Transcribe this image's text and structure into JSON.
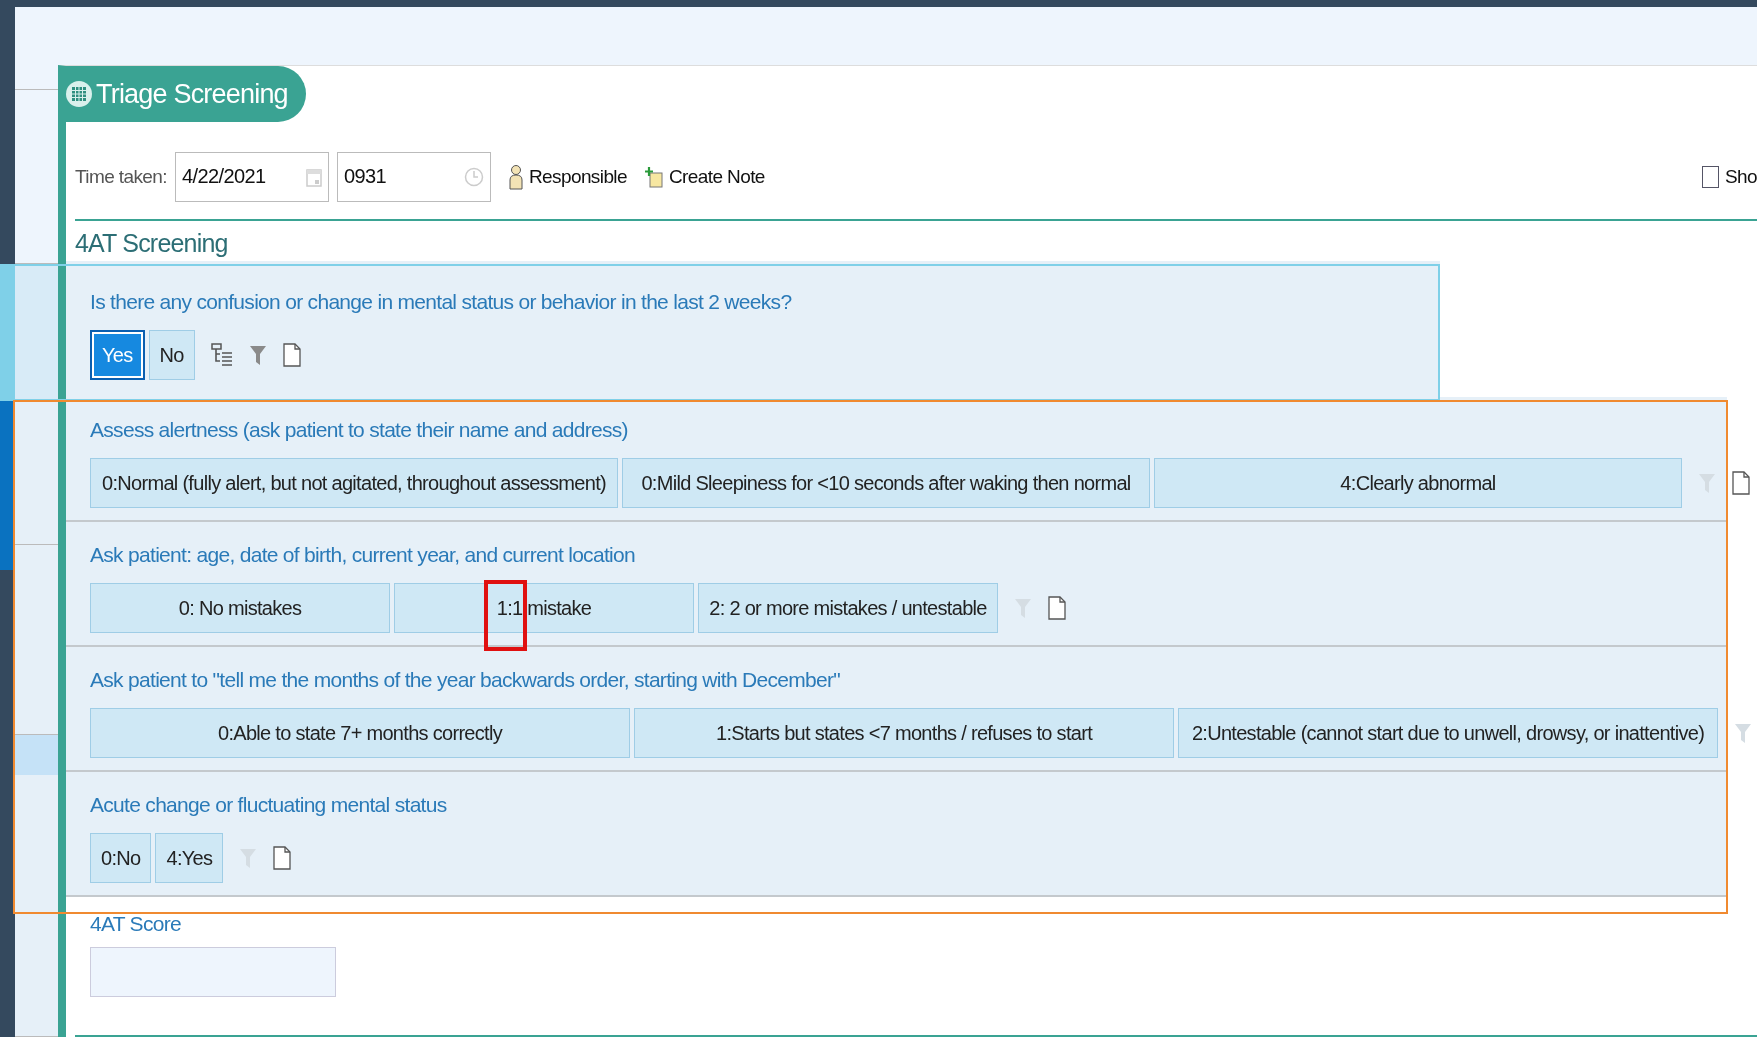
{
  "header": {
    "title": "Triage Screening"
  },
  "time_taken": {
    "label": "Time taken:",
    "date": "4/22/2021",
    "time": "0931"
  },
  "actions": {
    "responsible": "Responsible",
    "create_note": "Create Note"
  },
  "show_checkbox": {
    "label": "Sho",
    "checked": false
  },
  "section": {
    "title": "4AT Screening"
  },
  "questions": [
    {
      "text": "Is there any confusion or change in mental status or behavior in the last 2 weeks?",
      "options": [
        {
          "label": "Yes",
          "selected": true
        },
        {
          "label": "No",
          "selected": false
        }
      ]
    },
    {
      "text": "Assess alertness (ask patient to state their name and address)",
      "options": [
        {
          "label": "0:Normal (fully alert, but not agitated, throughout assessment)",
          "selected": false
        },
        {
          "label": "0:Mild Sleepiness for <10 seconds after waking then normal",
          "selected": false
        },
        {
          "label": "4:Clearly abnormal",
          "selected": false
        }
      ]
    },
    {
      "text": "Ask patient: age, date of birth, current year, and current location",
      "options": [
        {
          "label": "0: No mistakes",
          "selected": false
        },
        {
          "label": "1:1 mistake",
          "selected": false
        },
        {
          "label": "2: 2 or more mistakes / untestable",
          "selected": false
        }
      ]
    },
    {
      "text": "Ask patient to \"tell me the months of the year backwards order, starting with December\"",
      "options": [
        {
          "label": "0:Able to state 7+ months correctly",
          "selected": false
        },
        {
          "label": "1:Starts but states <7 months / refuses to start",
          "selected": false
        },
        {
          "label": "2:Untestable (cannot start due to unwell, drowsy, or inattentive)",
          "selected": false
        }
      ]
    },
    {
      "text": "Acute change or fluctuating mental status",
      "options": [
        {
          "label": "0:No",
          "selected": false
        },
        {
          "label": "4:Yes",
          "selected": false
        }
      ]
    }
  ],
  "score": {
    "label": "4AT Score"
  }
}
